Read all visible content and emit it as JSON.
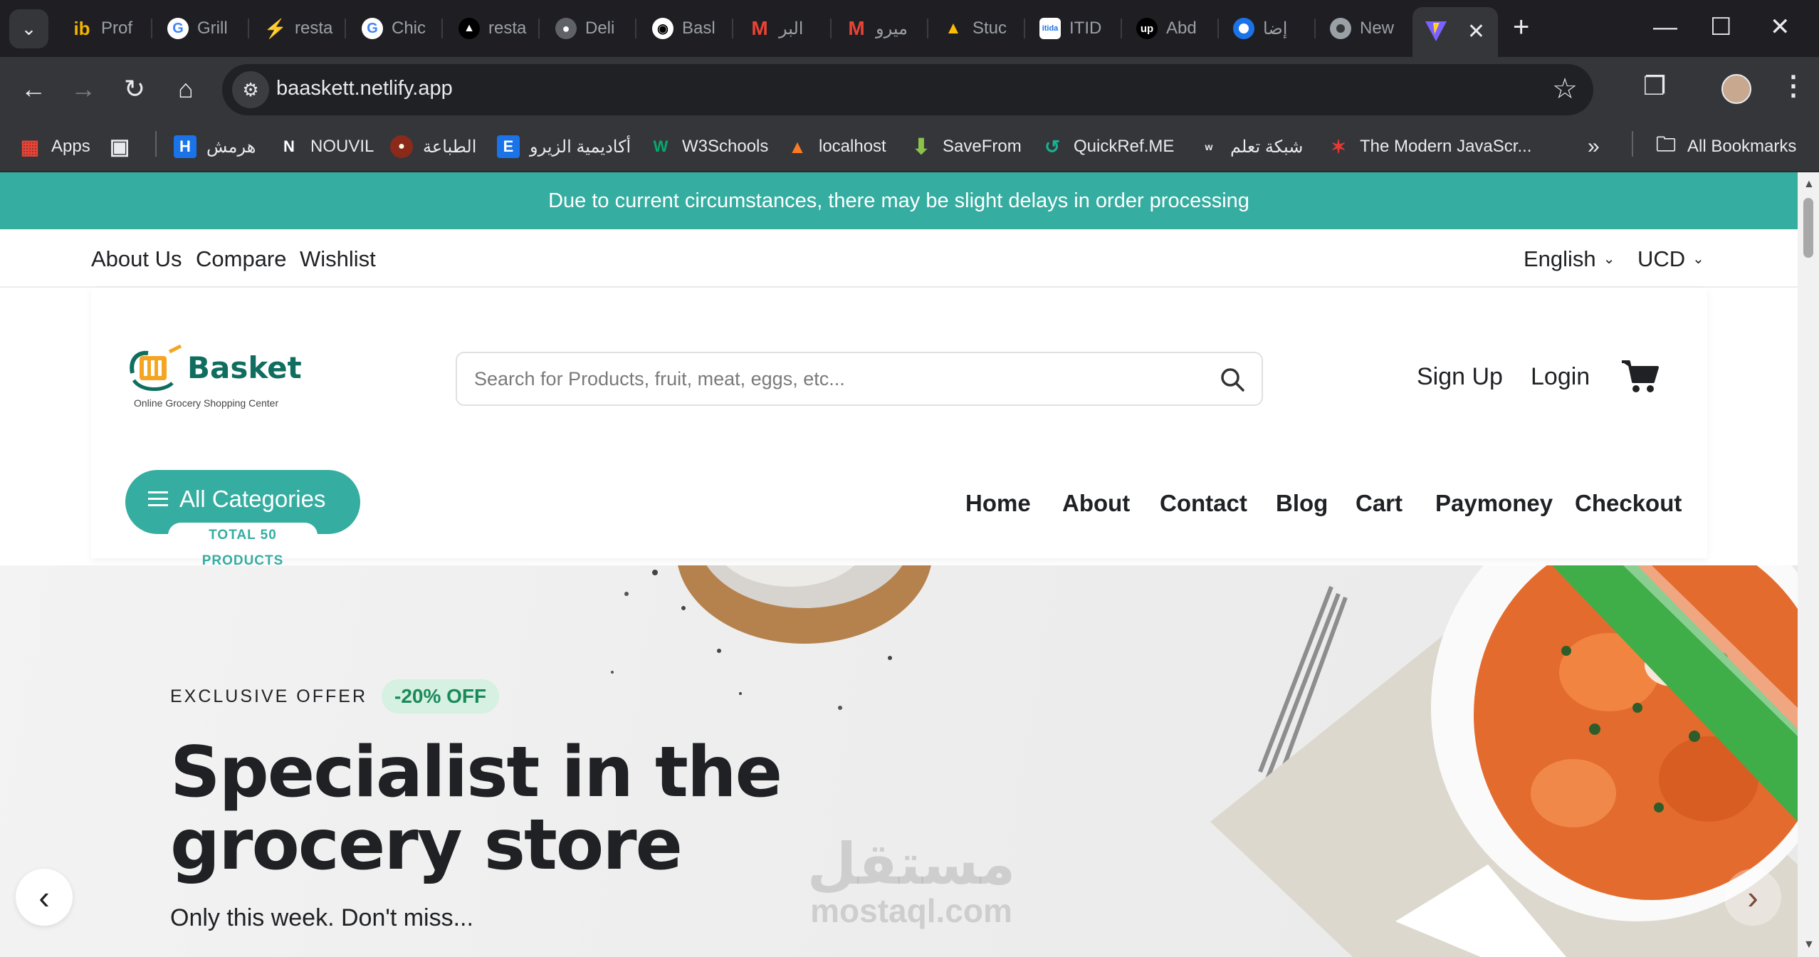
{
  "browser": {
    "tabs": [
      {
        "label": "Prof",
        "icon": "ib-icon",
        "color": "#f4b400"
      },
      {
        "label": "Grill",
        "icon": "google-icon",
        "color": "#ffffff"
      },
      {
        "label": "resta",
        "icon": "bolt-icon",
        "color": "#34a853"
      },
      {
        "label": "Chic",
        "icon": "google-icon",
        "color": "#ffffff"
      },
      {
        "label": "resta",
        "icon": "triangle-icon",
        "color": "#000000"
      },
      {
        "label": "Deli",
        "icon": "globe-icon",
        "color": "#5f6368"
      },
      {
        "label": "Basl",
        "icon": "github-icon",
        "color": "#ffffff"
      },
      {
        "label": "البر",
        "icon": "gmail-icon",
        "color": "#ea4335"
      },
      {
        "label": "ميرو",
        "icon": "gmail-icon",
        "color": "#ea4335"
      },
      {
        "label": "Stuc",
        "icon": "drive-icon",
        "color": "#fbbc04"
      },
      {
        "label": "ITID",
        "icon": "itida-icon",
        "color": "#ffffff"
      },
      {
        "label": "Abd",
        "icon": "upwork-icon",
        "color": "#14a800"
      },
      {
        "label": "إضا",
        "icon": "circle-icon",
        "color": "#1a73e8"
      },
      {
        "label": "New",
        "icon": "chrome-icon",
        "color": "#9aa0a6"
      }
    ],
    "active_tab_icon": "vite-icon",
    "url": "baaskett.netlify.app",
    "bookmarks": [
      {
        "label": "Apps",
        "icon": "apps-grid-icon"
      },
      {
        "label": "هرمش",
        "icon": "h-icon"
      },
      {
        "label": "NOUVIL",
        "icon": "n-icon"
      },
      {
        "label": "الطباعة",
        "icon": "print-shop-icon"
      },
      {
        "label": "أكاديمية الزيرو",
        "icon": "e-icon"
      },
      {
        "label": "W3Schools",
        "icon": "w3-icon"
      },
      {
        "label": "localhost",
        "icon": "xampp-icon"
      },
      {
        "label": "SaveFrom",
        "icon": "download-icon"
      },
      {
        "label": "QuickRef.ME",
        "icon": "quickref-icon"
      },
      {
        "label": "شبكة تعلم",
        "icon": "learn-net-icon"
      },
      {
        "label": "The Modern JavaScr...",
        "icon": "js-icon"
      }
    ],
    "all_bookmarks": "All Bookmarks"
  },
  "site": {
    "announcement": "Due to current circumstances, there may be slight delays in order processing",
    "top_links": [
      "About Us",
      "Compare",
      "Wishlist"
    ],
    "language": "English",
    "currency": "UCD",
    "logo": {
      "name": "Basket",
      "tagline": "Online Grocery Shopping Center"
    },
    "search_placeholder": "Search for Products, fruit, meat, eggs, etc...",
    "auth": {
      "signup": "Sign Up",
      "login": "Login"
    },
    "categories": {
      "label": "All Categories",
      "badge": "TOTAL 50 PRODUCTS"
    },
    "nav": [
      "Home",
      "About",
      "Contact",
      "Blog",
      "Cart",
      "Paymoney",
      "Checkout"
    ],
    "hero": {
      "offer_label": "EXCLUSIVE OFFER",
      "offer_badge": "-20% OFF",
      "title_line1": "Specialist in the",
      "title_line2": "grocery store",
      "subtitle": "Only this week. Don't miss..."
    },
    "watermark": {
      "ar": "مستقل",
      "en": "mostaql.com"
    },
    "accent": "#35ada0"
  }
}
